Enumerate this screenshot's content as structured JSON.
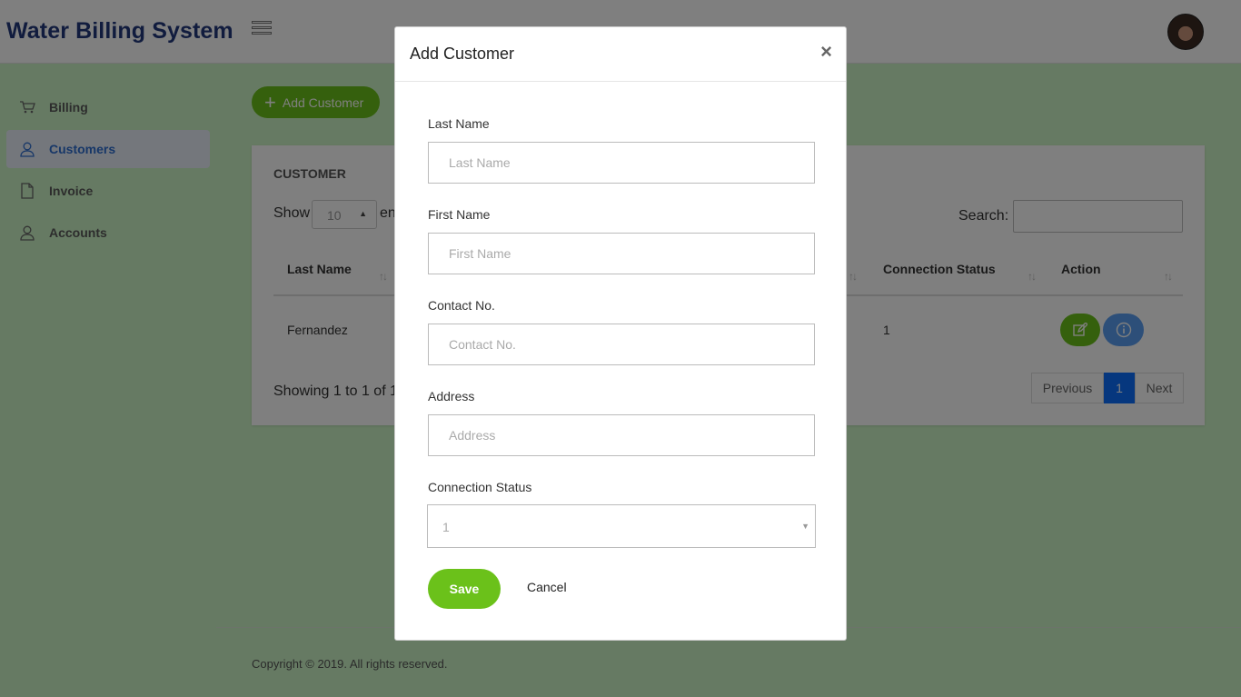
{
  "header": {
    "title": "Water Billing System",
    "menu_icon": "hamburger-menu-icon",
    "avatar_icon": "user-avatar"
  },
  "sidebar": {
    "items": [
      {
        "label": "Billing",
        "icon": "cart-icon",
        "active": false
      },
      {
        "label": "Customers",
        "icon": "user-icon",
        "active": true
      },
      {
        "label": "Invoice",
        "icon": "document-icon",
        "active": false
      },
      {
        "label": "Accounts",
        "icon": "user-icon",
        "active": false
      }
    ]
  },
  "main": {
    "add_button": {
      "label": "Add Customer",
      "icon": "plus-icon"
    },
    "card_title": "CUSTOMER",
    "length_menu": {
      "prefix": "Show",
      "value": "10",
      "suffix": "en"
    },
    "search_label": "Search:",
    "search_value": "",
    "table": {
      "columns": [
        {
          "label": "Last Name"
        },
        {
          "label": "Connection Status"
        },
        {
          "label": "Action"
        }
      ],
      "rows": [
        {
          "last_name": "Fernandez",
          "connection_status": "1",
          "actions": [
            "edit-icon",
            "info-icon"
          ]
        }
      ]
    },
    "info": "Showing 1 to 1 of 1",
    "pagination": {
      "previous": "Previous",
      "current": "1",
      "next": "Next"
    }
  },
  "footer": {
    "text": "Copyright © 2019. All rights reserved."
  },
  "modal": {
    "title": "Add Customer",
    "close_symbol": "×",
    "fields": [
      {
        "label": "Last Name",
        "placeholder": "Last Name",
        "value": ""
      },
      {
        "label": "First Name",
        "placeholder": "First Name",
        "value": ""
      },
      {
        "label": "Contact No.",
        "placeholder": "Contact No.",
        "value": ""
      },
      {
        "label": "Address",
        "placeholder": "Address",
        "value": ""
      }
    ],
    "select": {
      "label": "Connection Status",
      "value": "1"
    },
    "save_label": "Save",
    "cancel_label": "Cancel"
  },
  "colors": {
    "brand": "#23397c",
    "accent_green": "#6bc11a",
    "active_blue": "#2f6fd1",
    "page_bg": "#cdf5c7",
    "pager_active": "#0d6efd"
  }
}
